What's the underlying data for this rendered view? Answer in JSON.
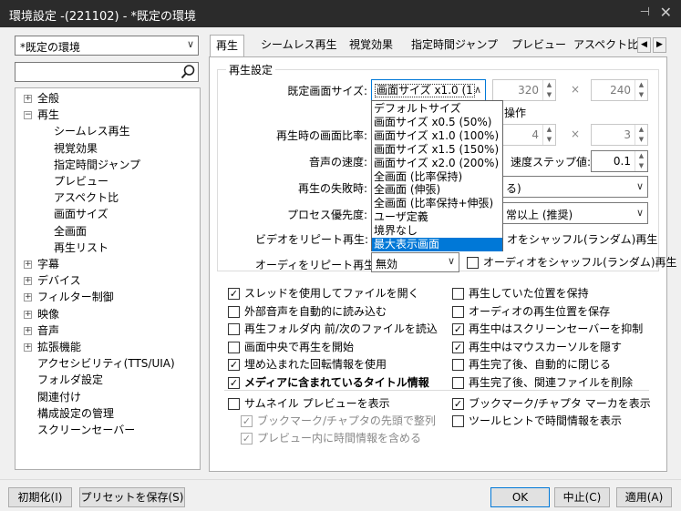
{
  "window": {
    "title": "環境設定 -(221102) - *既定の環境",
    "pin_glyph": "⊣",
    "close_glyph": "✕"
  },
  "left": {
    "profile": {
      "value": "*既定の環境",
      "arrow": "∨"
    },
    "search": {
      "placeholder": ""
    },
    "tree": [
      {
        "label": "全般",
        "level": 0,
        "expander": "+"
      },
      {
        "label": "再生",
        "level": 0,
        "expander": "−"
      },
      {
        "label": "シームレス再生",
        "level": 1
      },
      {
        "label": "視覚効果",
        "level": 1
      },
      {
        "label": "指定時間ジャンプ",
        "level": 1
      },
      {
        "label": "プレビュー",
        "level": 1
      },
      {
        "label": "アスペクト比",
        "level": 1
      },
      {
        "label": "画面サイズ",
        "level": 1
      },
      {
        "label": "全画面",
        "level": 1
      },
      {
        "label": "再生リスト",
        "level": 1
      },
      {
        "label": "字幕",
        "level": 0,
        "expander": "+"
      },
      {
        "label": "デバイス",
        "level": 0,
        "expander": "+"
      },
      {
        "label": "フィルター制御",
        "level": 0,
        "expander": "+"
      },
      {
        "label": "映像",
        "level": 0,
        "expander": "+"
      },
      {
        "label": "音声",
        "level": 0,
        "expander": "+"
      },
      {
        "label": "拡張機能",
        "level": 0,
        "expander": "+"
      },
      {
        "label": "アクセシビリティ(TTS/UIA)",
        "level": 0
      },
      {
        "label": "フォルダ設定",
        "level": 0
      },
      {
        "label": "関連付け",
        "level": 0
      },
      {
        "label": "構成設定の管理",
        "level": 0
      },
      {
        "label": "スクリーンセーバー",
        "level": 0
      }
    ]
  },
  "tabs": [
    "再生",
    "シームレス再生",
    "視覚効果",
    "指定時間ジャンプ",
    "プレビュー",
    "アスペクト比"
  ],
  "tabnav": {
    "prev": "◀",
    "next": "▶"
  },
  "playback": {
    "group_title": "再生設定",
    "default_size_label": "既定画面サイズ:",
    "default_size_value": "画面サイズ x1.0 (1",
    "default_size_arrow": "∧",
    "width": "320",
    "height": "240",
    "times": "×",
    "operation_label": "操作",
    "aspect_label": "再生時の画面比率:",
    "aspect_w": "4",
    "aspect_h": "3",
    "speed_label": "音声の速度:",
    "speed_step_label": "速度ステップ値:",
    "speed_step": "0.1",
    "fail_label": "再生の失敗時:",
    "fail_value_partial": "る)",
    "priority_label": "プロセス優先度:",
    "priority_value_partial": "常以上 (推奨)",
    "video_repeat_label": "ビデオをリピート再生:",
    "video_shuffle": "オをシャッフル(ランダム)再生",
    "audio_repeat_label": "オーディをリピート再生:",
    "audio_repeat_value": "無効",
    "audio_shuffle": "オーディオをシャッフル(ランダム)再生",
    "spin_up": "▲",
    "spin_down": "▼",
    "combo_arrow": "∨"
  },
  "dropdown": {
    "items": [
      "デフォルトサイズ",
      "画面サイズ x0.5 (50%)",
      "画面サイズ x1.0 (100%)",
      "画面サイズ x1.5 (150%)",
      "画面サイズ x2.0 (200%)",
      "全画面 (比率保持)",
      "全画面 (伸張)",
      "全画面 (比率保持+伸張)",
      "ユーザ定義",
      "境界なし",
      "最大表示画面"
    ],
    "selected_index": 10
  },
  "checks": {
    "left": [
      {
        "label": "スレッドを使用してファイルを開く",
        "checked": true
      },
      {
        "label": "外部音声を自動的に読み込む",
        "checked": false
      },
      {
        "label": "再生フォルダ内 前/次のファイルを読込",
        "checked": false
      },
      {
        "label": "画面中央で再生を開始",
        "checked": false
      },
      {
        "label": "埋め込まれた回転情報を使用",
        "checked": true
      },
      {
        "label": "メディアに含まれているタイトル情報",
        "checked": true,
        "bold": true
      }
    ],
    "right": [
      {
        "label": "再生していた位置を保持",
        "checked": false
      },
      {
        "label": "オーディオの再生位置を保存",
        "checked": false
      },
      {
        "label": "再生中はスクリーンセーバーを抑制",
        "checked": true
      },
      {
        "label": "再生中はマウスカーソルを隠す",
        "checked": true
      },
      {
        "label": "再生完了後、自動的に閉じる",
        "checked": false
      },
      {
        "label": "再生完了後、関連ファイルを削除",
        "checked": false
      }
    ],
    "thumb": {
      "label": "サムネイル プレビューを表示",
      "checked": false
    },
    "thumb_sub": [
      {
        "label": "ブックマーク/チャプタの先頭で整列",
        "checked": true
      },
      {
        "label": "プレビュー内に時間情報を含める",
        "checked": true
      }
    ],
    "bookmark": {
      "label": "ブックマーク/チャプタ マーカを表示",
      "checked": true
    },
    "tooltip": {
      "label": "ツールヒントで時間情報を表示",
      "checked": false
    },
    "check_glyph": "✓"
  },
  "footer": {
    "reset": "初期化(I)",
    "save_preset": "プリセットを保存(S)",
    "ok": "OK",
    "cancel": "中止(C)",
    "apply": "適用(A)"
  }
}
